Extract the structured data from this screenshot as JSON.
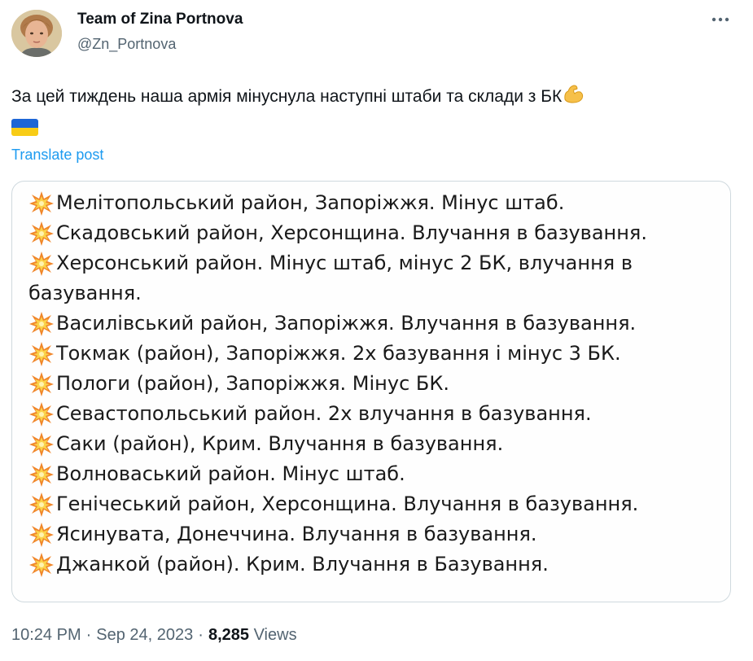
{
  "author": {
    "display_name": "Team of Zina Portnova",
    "handle": "@Zn_Portnova",
    "avatar_icon": "portrait-avatar"
  },
  "more_icon": "more-horizontal-icon",
  "tweet": {
    "text": "За цей тиждень наша армія мінуснула наступні штаби та склади з БК",
    "trailing_emoji": "flexed-biceps-emoji",
    "flag_emoji": "ukraine-flag-emoji",
    "translate_label": "Translate post"
  },
  "media": {
    "bullet_icon": "collision-emoji",
    "lines": [
      {
        "text": "Мелітопольський район, Запоріжжя. Мінус штаб.",
        "bullet": true
      },
      {
        "text": "Скадовський район, Херсонщина. Влучання в базування.",
        "bullet": true
      },
      {
        "text": "Херсонський район. Мінус штаб, мінус 2 БК, влучання в",
        "bullet": true
      },
      {
        "text": "базування.",
        "bullet": false
      },
      {
        "text": "Василівський район, Запоріжжя. Влучання в базування.",
        "bullet": true
      },
      {
        "text": "Токмак (район), Запоріжжя. 2х базування і мінус 3 БК.",
        "bullet": true
      },
      {
        "text": "Пологи (район), Запоріжжя. Мінус БК.",
        "bullet": true
      },
      {
        "text": "Севастопольський район. 2х влучання в базування.",
        "bullet": true
      },
      {
        "text": "Саки (район), Крим. Влучання в базування.",
        "bullet": true
      },
      {
        "text": "Волноваський район. Мінус штаб.",
        "bullet": true
      },
      {
        "text": "Генічеський район, Херсонщина. Влучання в базування.",
        "bullet": true
      },
      {
        "text": "Ясинувата, Донеччина. Влучання в базування.",
        "bullet": true
      },
      {
        "text": "Джанкой (район). Крим. Влучання в Базування.",
        "bullet": true
      }
    ]
  },
  "meta": {
    "time": "10:24 PM",
    "separator": "·",
    "date": "Sep 24, 2023",
    "views_count": "8,285",
    "views_label": "Views"
  },
  "colors": {
    "link": "#1d9bf0",
    "secondary_text": "#536471",
    "primary_text": "#0f1419",
    "border": "#cfd9de",
    "flag_blue": "#1d66d6",
    "flag_yellow": "#f8cc16"
  }
}
